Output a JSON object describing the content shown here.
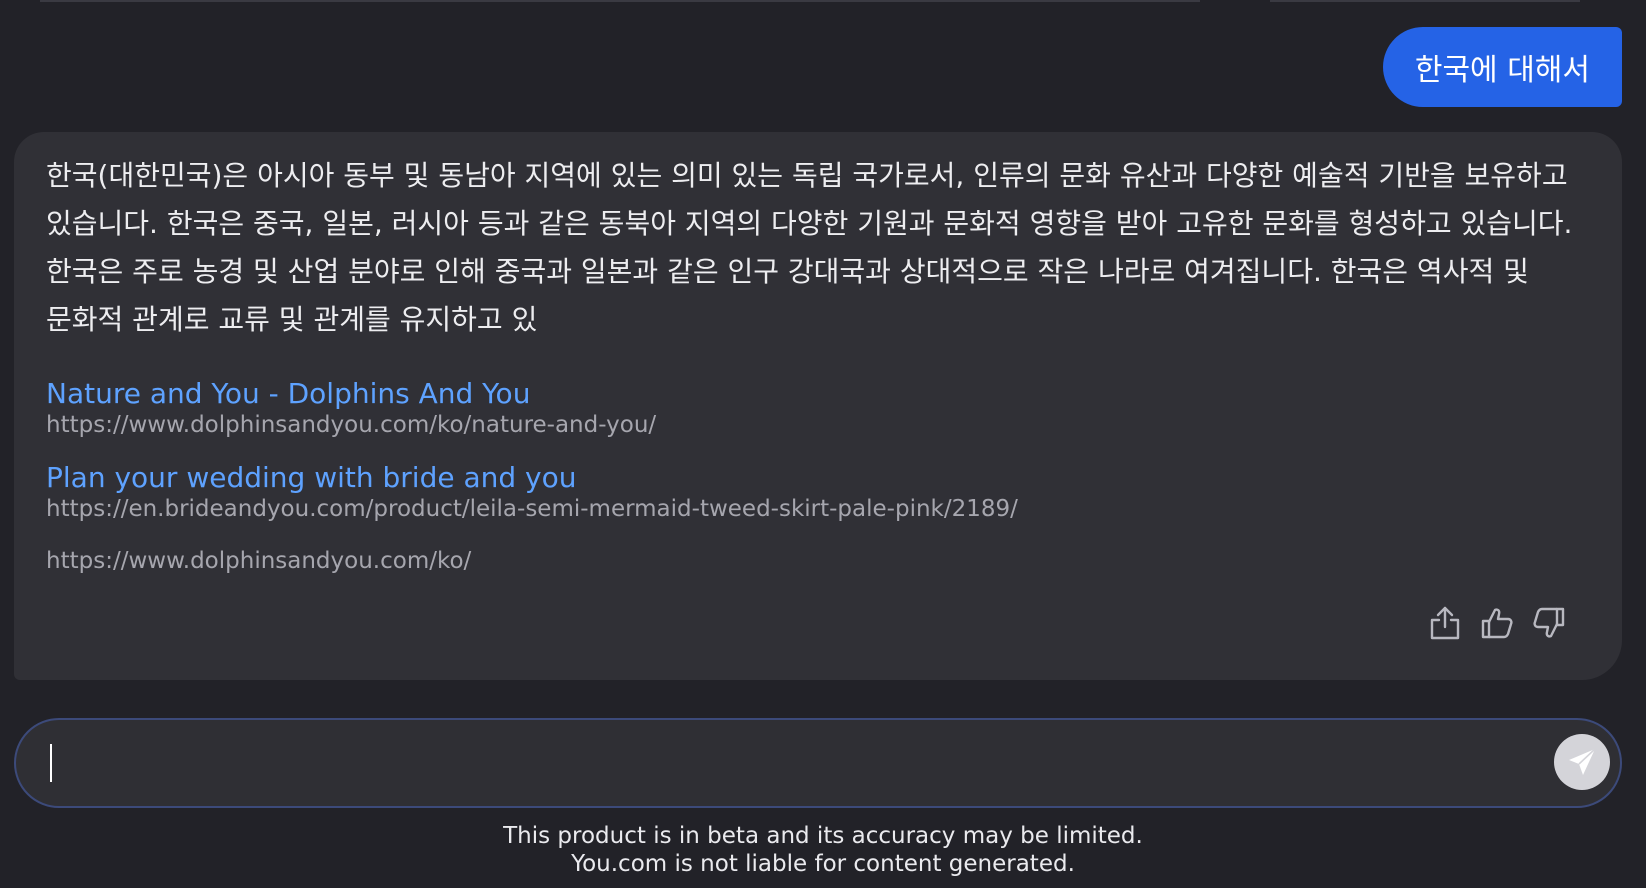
{
  "user_message": "한국에 대해서",
  "answer": {
    "text": "한국(대한민국)은 아시아 동부 및 동남아 지역에 있는 의미 있는 독립 국가로서, 인류의 문화 유산과 다양한 예술적 기반을 보유하고 있습니다. 한국은 중국, 일본, 러시아 등과 같은 동북아 지역의 다양한 기원과 문화적 영향을 받아 고유한 문화를 형성하고 있습니다. 한국은 주로 농경 및 산업 분야로 인해 중국과 일본과 같은 인구 강대국과 상대적으로 작은 나라로 여겨집니다. 한국은 역사적 및 문화적 관계로 교류 및 관계를 유지하고 있",
    "sources": [
      {
        "title": "Nature and You - Dolphins And You",
        "url": "https://www.dolphinsandyou.com/ko/nature-and-you/"
      },
      {
        "title": "Plan your wedding with bride and you",
        "url": "https://en.brideandyou.com/product/leila-semi-mermaid-tweed-skirt-pale-pink/2189/"
      },
      {
        "title": "",
        "url": "https://www.dolphinsandyou.com/ko/"
      }
    ],
    "actions": {
      "share_icon": "share-icon",
      "thumbs_up_icon": "thumbs-up-icon",
      "thumbs_down_icon": "thumbs-down-icon"
    }
  },
  "input": {
    "value": "",
    "placeholder": "",
    "send_icon": "send-icon"
  },
  "disclaimer": {
    "line1": "This product is in beta and its accuracy may be limited.",
    "line2": "You.com is not liable for content generated."
  },
  "colors": {
    "background": "#222228",
    "card": "#303036",
    "user_bubble": "#2563e6",
    "link": "#5ea2ff",
    "url": "#a6a6ae"
  }
}
